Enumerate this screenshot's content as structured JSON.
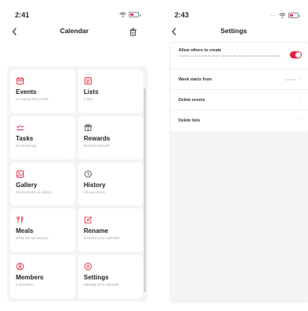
{
  "colors": {
    "accent": "#e5203e",
    "tile_bg": "#ffffff",
    "page_bg": "#f4f4f6"
  },
  "left": {
    "status": {
      "time": "2:41",
      "battery_level": 0.35
    },
    "nav": {
      "title": "Calendar",
      "back_icon": "chevron-left-icon",
      "trash_icon": "trash-icon"
    },
    "tiles": [
      {
        "title": "Events",
        "sub": "21 events this month",
        "icon": "calendar-icon"
      },
      {
        "title": "Lists",
        "sub": "2 lists",
        "icon": "list-icon"
      },
      {
        "title": "Tasks",
        "sub": "10 remaining",
        "icon": "tasks-icon"
      },
      {
        "title": "Rewards",
        "sub": "Reward yourself",
        "icon": "reward-icon"
      },
      {
        "title": "Gallery",
        "sub": "Share photos & videos",
        "icon": "gallery-icon"
      },
      {
        "title": "History",
        "sub": "All your items",
        "icon": "history-icon"
      },
      {
        "title": "Meals",
        "sub": "What are we eating?",
        "icon": "meals-icon"
      },
      {
        "title": "Rename",
        "sub": "Rename your calendar",
        "icon": "rename-icon"
      },
      {
        "title": "Members",
        "sub": "4 members",
        "icon": "members-icon"
      },
      {
        "title": "Settings",
        "sub": "Manage your calendar",
        "icon": "settings-icon"
      }
    ]
  },
  "right": {
    "status": {
      "time": "2:43",
      "battery_level": 0.35
    },
    "nav": {
      "title": "Settings",
      "back_icon": "chevron-left-icon"
    },
    "rows": {
      "allow": {
        "label": "Allow others to create",
        "desc": "Enable to let members create new events, tasks and lists in this calendar.",
        "on": true
      },
      "week": {
        "label": "Week starts from",
        "value": "Sunday"
      },
      "delete_events": {
        "label": "Delete events"
      },
      "delete_lists": {
        "label": "Delete lists"
      }
    }
  }
}
